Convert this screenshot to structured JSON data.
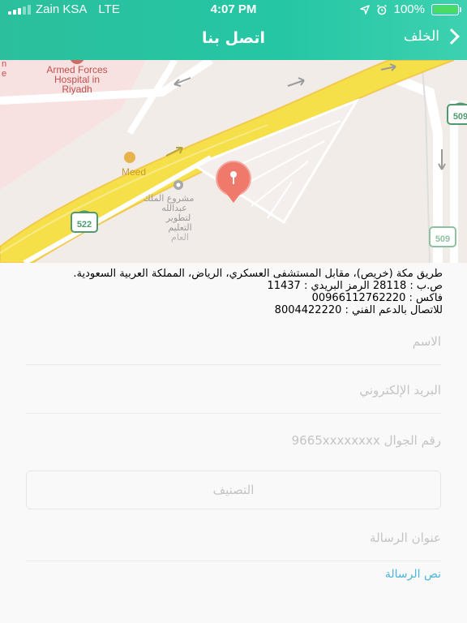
{
  "status_bar": {
    "carrier": "Zain KSA",
    "network": "LTE",
    "time": "4:07 PM",
    "battery": "100%",
    "battery_level": 1.0,
    "icons": [
      "location-arrow-icon",
      "alarm-icon",
      "battery-icon"
    ]
  },
  "nav": {
    "title": "اتصل بنا",
    "back_label": "الخلف",
    "back_icon": "chevron-right-icon"
  },
  "map": {
    "labels": {
      "hospital_line1": "Armed Forces",
      "hospital_line2": "Hospital in",
      "hospital_line3": "Riyadh",
      "meed": "Meed",
      "project_line1": "مشروع الملك",
      "project_line2": "عبدالله",
      "project_line3": "لتطوير",
      "project_line4": "التعليم",
      "project_line5": "العام",
      "road_522": "522",
      "road_509_top": "509",
      "road_509_bottom": "509",
      "edge_n": "n",
      "edge_e": "e"
    },
    "colors": {
      "highway": "#f6e04a",
      "highway_edge": "#f2c94c",
      "land": "#f2ece8",
      "pin": "#ef7a6c"
    }
  },
  "address": {
    "line1": "طريق مكة (خريص)، مقابل المستشفى العسكري، الرياض، المملكة العربية السعودية.",
    "line2": "ص.ب : 28118 الرمز البريدي : 11437",
    "line3": "فاكس : 00966112762220",
    "line4": "للاتصال بالدعم الفني : 8004422220"
  },
  "form": {
    "name_placeholder": "الاسم",
    "email_placeholder": "البريد الإلكتروني",
    "mobile_placeholder": "رقم الجوال 9665xxxxxxxx",
    "category_placeholder": "التصنيف",
    "subject_placeholder": "عنوان الرسالة",
    "message_link": "نص الرسالة"
  },
  "colors": {
    "header_start": "#2bbf9d",
    "header_end": "#3dd1b0",
    "link": "#4eb6d6",
    "placeholder": "#c4c4c4"
  }
}
